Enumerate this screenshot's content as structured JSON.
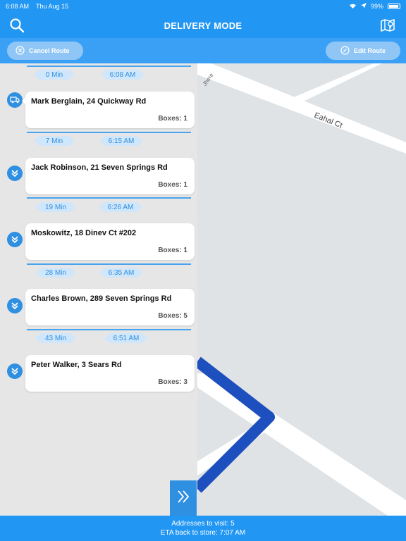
{
  "status_bar": {
    "time": "6:08 AM",
    "date": "Thu Aug 15",
    "battery": "99%"
  },
  "nav": {
    "title": "DELIVERY MODE",
    "search_icon": "search-icon",
    "map_icon": "map-pin-icon"
  },
  "toolbar": {
    "cancel_label": "Cancel Route",
    "edit_label": "Edit Route"
  },
  "map": {
    "street_labels": [
      "Eahal  Ct",
      "Jhere"
    ],
    "route_color": "#1e4fbf"
  },
  "stops": [
    {
      "min": "0 Min",
      "eta": "6:08 AM",
      "address": "Mark Berglain, 24 Quickway Rd",
      "boxes": "Boxes: 1",
      "icon": "truck-icon"
    },
    {
      "min": "7 Min",
      "eta": "6:15 AM",
      "address": "Jack Robinson, 21 Seven Springs Rd",
      "boxes": "Boxes: 1",
      "icon": "double-chevron-down-icon"
    },
    {
      "min": "19 Min",
      "eta": "6:26 AM",
      "address": "Moskowitz, 18 Dinev Ct  #202",
      "boxes": "Boxes: 1",
      "icon": "double-chevron-down-icon"
    },
    {
      "min": "28 Min",
      "eta": "6:35 AM",
      "address": "Charles Brown, 289 Seven Springs Rd",
      "boxes": "Boxes: 5",
      "icon": "double-chevron-down-icon"
    },
    {
      "min": "43 Min",
      "eta": "6:51 AM",
      "address": "Peter Walker, 3 Sears Rd",
      "boxes": "Boxes: 3",
      "icon": "double-chevron-down-icon"
    }
  ],
  "footer": {
    "addresses": "Addresses to visit: 5",
    "eta_store": "ETA back to store: 7:07 AM"
  },
  "colors": {
    "primary": "#2196f3",
    "accent": "#2f8fe0",
    "tag_bg": "#cfe6fb"
  }
}
